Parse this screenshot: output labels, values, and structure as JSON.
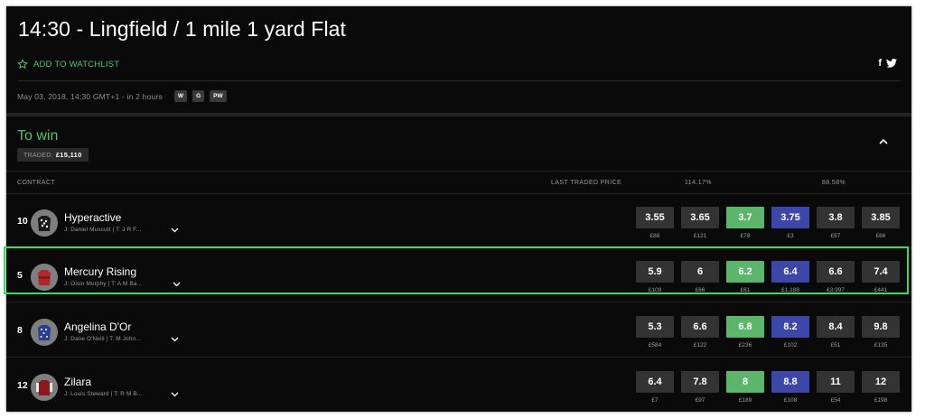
{
  "header": {
    "title": "14:30 - Lingfield / 1 mile 1 yard Flat",
    "watchlist_label": "ADD TO WATCHLIST",
    "date_line": "May 03, 2018, 14:30 GMT+1 - in 2 hours",
    "chips": [
      "W",
      "G",
      "PW"
    ],
    "social": {
      "facebook": "f",
      "twitter": "🐦"
    }
  },
  "market": {
    "name": "To win",
    "traded_label": "TRADED:",
    "traded_value": "£15,110"
  },
  "columns": {
    "contract": "CONTRACT",
    "last_traded": "LAST TRADED PRICE",
    "back_overround": "114.17%",
    "lay_overround": "88.58%"
  },
  "runners": [
    {
      "number": "10",
      "name": "Hyperactive",
      "jockey_trainer": "J: Daniel Muscutt | T: J R F...",
      "silk_color": "#1a1a1a",
      "odds": [
        "3.55",
        "3.65",
        "3.7",
        "3.75",
        "3.8",
        "3.85"
      ],
      "volumes": [
        "£88",
        "£121",
        "£78",
        "£3",
        "£97",
        "£66"
      ]
    },
    {
      "number": "5",
      "name": "Mercury Rising",
      "jockey_trainer": "J: Oisin Murphy | T: A M Ba...",
      "silk_color": "#b0282a",
      "odds": [
        "5.9",
        "6",
        "6.2",
        "6.4",
        "6.6",
        "7.4"
      ],
      "volumes": [
        "£109",
        "£66",
        "£61",
        "£1,188",
        "£3,997",
        "£441"
      ]
    },
    {
      "number": "8",
      "name": "Angelina D'Or",
      "jockey_trainer": "J: Dane O'Neill | T: M John...",
      "silk_color": "#2a3f8f",
      "odds": [
        "5.3",
        "6.6",
        "6.8",
        "8.2",
        "8.4",
        "9.8"
      ],
      "volumes": [
        "£584",
        "£122",
        "£236",
        "£102",
        "£51",
        "£135"
      ]
    },
    {
      "number": "12",
      "name": "Zilara",
      "jockey_trainer": "J: Louis Steward | T: R M B...",
      "silk_color": "#8b1a1a",
      "odds": [
        "6.4",
        "7.8",
        "8",
        "8.8",
        "11",
        "12"
      ],
      "volumes": [
        "£7",
        "£97",
        "£189",
        "£108",
        "£54",
        "£198"
      ]
    }
  ],
  "colors": {
    "accent_green": "#4fc36a",
    "best_lay": "#5bb56a",
    "best_back": "#3d47aa",
    "highlight": "#2de06a"
  },
  "icons": {
    "watchlist": "star-outline-icon",
    "collapse": "chevron-up-icon",
    "expand": "chevron-down-icon",
    "silk": "jockey-silk-icon"
  }
}
